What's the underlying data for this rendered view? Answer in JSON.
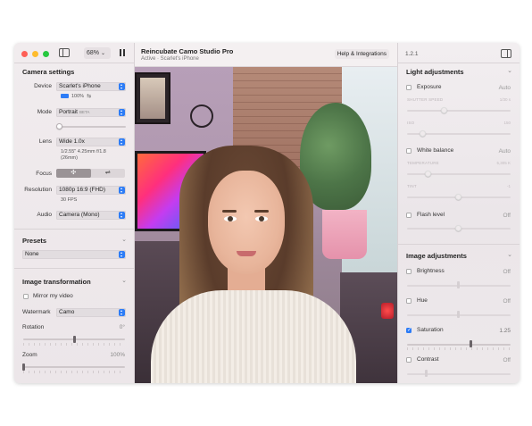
{
  "window": {
    "zoom": "68%",
    "zoom_chevron": "⌄",
    "pause_icon": "pause-icon"
  },
  "header": {
    "title": "Reincubate Camo Studio Pro",
    "subtitle": "Active · Scarlet's iPhone",
    "help_label": "Help & Integrations"
  },
  "left": {
    "camera_settings": {
      "title": "Camera settings",
      "device_label": "Device",
      "device_value": "Scarlet's iPhone",
      "battery": "100%",
      "mode_label": "Mode",
      "mode_value": "Portrait",
      "mode_badge": "BETA",
      "portrait_strength": 0.0,
      "lens_label": "Lens",
      "lens_value": "Wide 1.0x",
      "lens_specs": "1/2.55\" 4.25mm f/1.8",
      "lens_specs2": "(26mm)",
      "focus_label": "Focus",
      "focus_mode_auto": "✣",
      "focus_mode_manual": "⇌",
      "resolution_label": "Resolution",
      "resolution_value": "1080p 16:9 (FHD)",
      "fps": "30 FPS",
      "audio_label": "Audio",
      "audio_value": "Camera (Mono)"
    },
    "presets": {
      "title": "Presets",
      "value": "None"
    },
    "image_transformation": {
      "title": "Image transformation",
      "mirror_label": "Mirror my video",
      "mirror_checked": false,
      "watermark_label": "Watermark",
      "watermark_value": "Camo",
      "rotation_label": "Rotation",
      "rotation_value": "0°",
      "rotation_fraction": 0.5,
      "zoom_label": "Zoom",
      "zoom_value": "100%",
      "zoom_fraction": 0.0
    }
  },
  "right": {
    "version": "1.2.1",
    "light": {
      "title": "Light adjustments",
      "exposure_label": "Exposure",
      "exposure_value": "Auto",
      "shutter_label": "SHUTTER SPEED",
      "shutter_value": "1/30 s",
      "iso_label": "ISO",
      "iso_value": "150",
      "white_balance_label": "White balance",
      "white_balance_value": "Auto",
      "temperature_label": "TEMPERATURE",
      "temperature_value": "5,305 K",
      "tint_label": "TINT",
      "tint_value": "-1",
      "flash_label": "Flash level",
      "flash_value": "Off"
    },
    "image": {
      "title": "Image adjustments",
      "brightness_label": "Brightness",
      "brightness_value": "Off",
      "hue_label": "Hue",
      "hue_value": "Off",
      "saturation_label": "Saturation",
      "saturation_value": "1.25",
      "saturation_checked": true,
      "contrast_label": "Contrast",
      "contrast_value": "Off"
    }
  },
  "colors": {
    "accent": "#2d7cf6",
    "close": "#fe5f57",
    "minimize": "#febc2e",
    "zoom": "#28c840"
  }
}
